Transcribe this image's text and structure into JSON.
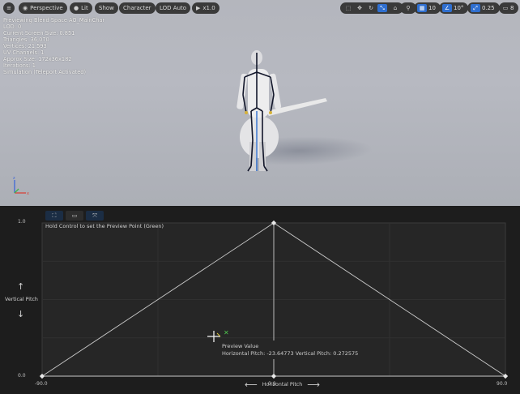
{
  "toolbar": {
    "menu_icon": "hamburger-icon",
    "perspective_label": "Perspective",
    "lit_label": "Lit",
    "show_label": "Show",
    "character_label": "Character",
    "lod_label": "LOD Auto",
    "play_speed": "x1.0",
    "grid_snap_value": "10",
    "rotation_snap_value": "10°",
    "scale_snap_value": "0.25",
    "camera_speed_value": "8"
  },
  "stats": {
    "line1": "Previewing Blend Space AO_MainChar",
    "line2": "LOD: 0",
    "line3": "Current Screen Size: 0.851",
    "line4": "Triangles: 36,070",
    "line5": "Vertices: 21,593",
    "line6": "UV Channels: 1",
    "line7": "Approx Size: 172x36x182",
    "line8": "Iterations: 1",
    "line9": "Simulation (Teleport Activated)"
  },
  "editor": {
    "hint": "Hold Control to set the Preview Point (Green)",
    "vertical_axis_label": "Vertical Pitch",
    "horizontal_axis_label": "Horizontal Pitch",
    "y_ticks": [
      "1.0",
      "0.0"
    ],
    "x_ticks": [
      "-90.0",
      "0.0",
      "90.0"
    ],
    "tooltip_title": "Preview Value",
    "tooltip_value": "Horizontal Pitch: -23.64773  Vertical Pitch: 0.272575"
  },
  "chart_data": {
    "type": "scatter",
    "title": "",
    "xlabel": "Horizontal Pitch",
    "ylabel": "Vertical Pitch",
    "xlim": [
      -90,
      90
    ],
    "ylim": [
      0,
      1
    ],
    "grid": true,
    "sample_points": [
      {
        "x": -90,
        "y": 0
      },
      {
        "x": 0,
        "y": 0
      },
      {
        "x": 90,
        "y": 0
      },
      {
        "x": 0,
        "y": 1
      }
    ],
    "triangulation": [
      [
        0,
        1,
        3
      ],
      [
        1,
        2,
        3
      ]
    ],
    "preview_point": {
      "x": -23.64773,
      "y": 0.272575
    }
  }
}
